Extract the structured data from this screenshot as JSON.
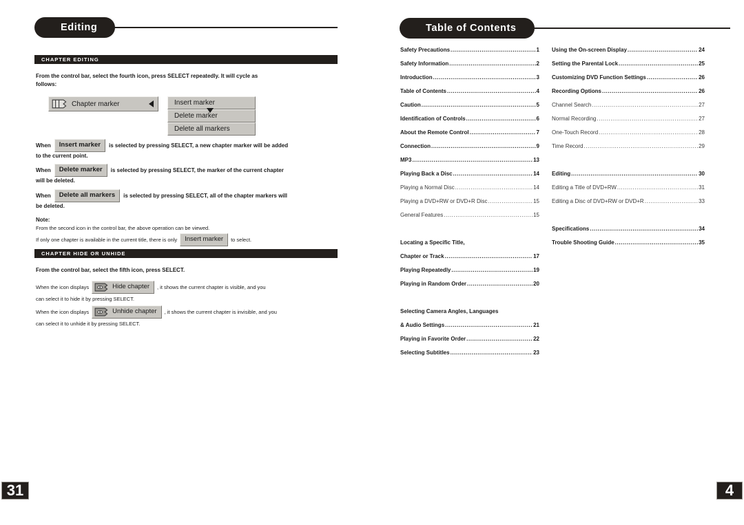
{
  "left_page": {
    "header": {
      "title": "Editing"
    },
    "page_number": "31",
    "sections": [
      {
        "band": "CHAPTER EDITING"
      },
      {
        "band": "CHAPTER HIDE OR UNHIDE"
      }
    ],
    "intro_line1": "From the control bar, select the fourth icon, press SELECT repeatedly. It will cycle as",
    "intro_line2": "follows:",
    "diagram": {
      "control_label": "Chapter marker",
      "control_icon": "chapter-marker-icon",
      "menu_options": [
        "Insert marker",
        "Delete marker",
        "Delete all markers"
      ]
    },
    "rules": [
      {
        "prefix": "When",
        "chip": "Insert marker",
        "line1": "is selected by pressing SELECT, a new chapter marker will be added",
        "line2": "to the current  point."
      },
      {
        "prefix": "When",
        "chip": "Delete marker",
        "line1": "is selected by pressing SELECT, the marker of the current chapter",
        "line2": "will be deleted."
      },
      {
        "prefix": "When",
        "chip": "Delete all markers",
        "line1": "is selected by pressing SELECT, all of the chapter markers will",
        "line2": "be deleted."
      }
    ],
    "note": {
      "title": "Note:",
      "line1": "From the second icon in the control bar, the above operation can be viewed.",
      "line2_a": "If only one chapter is available in the current title, there is only",
      "line2_chip": "Insert marker",
      "line2_b": "to select."
    },
    "hide_section": {
      "intro": "From the control bar, select the fifth icon, press SELECT.",
      "items": [
        {
          "prefix": "When the icon displays",
          "chip": "Hide chapter",
          "chip_icon": "hide-chapter-icon",
          "line1": ", it shows the current chapter is visible, and you",
          "line2": "can select it to hide it by pressing SELECT."
        },
        {
          "prefix": "When the icon displays",
          "chip": "Unhide chapter",
          "chip_icon": "unhide-chapter-icon",
          "line1": ", it shows the current chapter is invisible, and you",
          "line2": "can select it to unhide it by pressing SELECT."
        }
      ]
    }
  },
  "right_page": {
    "header": {
      "title": "Table of Contents"
    },
    "page_number": "4",
    "toc_left": [
      {
        "text": "Safety Precautions",
        "page": "1",
        "style": "bold"
      },
      {
        "text": "Safety Information",
        "page": "2",
        "style": "bold"
      },
      {
        "text": "Introduction",
        "page": "3",
        "style": "bold"
      },
      {
        "text": "Table of Contents",
        "page": "4",
        "style": "bold"
      },
      {
        "text": "Caution",
        "page": " 5",
        "style": "bold"
      },
      {
        "text": "Identification of Controls",
        "page": "6",
        "style": "bold"
      },
      {
        "text": "About the Remote Control",
        "page": "7",
        "style": "bold"
      },
      {
        "text": "Connection",
        "page": "9",
        "style": "bold"
      },
      {
        "text": "MP3",
        "page": "13",
        "style": "bold"
      },
      {
        "text": "Playing Back a Disc",
        "page": "14",
        "style": "bold"
      },
      {
        "text": "Playing a Normal Disc",
        "page": "14",
        "style": "plain"
      },
      {
        "text": "Playing a DVD+RW or DVD+R Disc",
        "page": "15",
        "style": "plain"
      },
      {
        "text": "General Features",
        "page": "15",
        "style": "plain"
      },
      {
        "text": "",
        "page": "",
        "style": "gap"
      },
      {
        "text": "Locating a Specific Title,",
        "page": "",
        "style": "bold-nopage"
      },
      {
        "text": "Chapter or Track",
        "page": "17",
        "style": "bold"
      },
      {
        "text": "Playing Repeatedly",
        "page": "19",
        "style": "bold"
      },
      {
        "text": "Playing in Random Order",
        "page": "20",
        "style": "bold"
      },
      {
        "text": "",
        "page": "",
        "style": "gap"
      },
      {
        "text": "Selecting Camera Angles, Languages",
        "page": "",
        "style": "bold-nopage"
      },
      {
        "text": "& Audio Settings",
        "page": "21",
        "style": "bold"
      },
      {
        "text": "Playing in Favorite Order",
        "page": " 22",
        "style": "bold"
      },
      {
        "text": "Selecting Subtitles",
        "page": " 23",
        "style": "bold"
      }
    ],
    "toc_right": [
      {
        "text": "Using the On-screen Display",
        "page": "24",
        "style": "bold"
      },
      {
        "text": "Setting the Parental Lock",
        "page": "25",
        "style": "bold"
      },
      {
        "text": "Customizing DVD Function Settings",
        "page": "26",
        "style": "bold"
      },
      {
        "text": "Recording Options",
        "page": "26",
        "style": "bold"
      },
      {
        "text": "Channel Search",
        "page": "27",
        "style": "plain"
      },
      {
        "text": "Normal Recording",
        "page": "27",
        "style": "plain"
      },
      {
        "text": "One-Touch Record",
        "page": "28",
        "style": "plain"
      },
      {
        "text": "Time Record",
        "page": "29",
        "style": "plain"
      },
      {
        "text": "",
        "page": "",
        "style": "gap"
      },
      {
        "text": "Editing",
        "page": "30",
        "style": "bold"
      },
      {
        "text": "Editing a Title of DVD+RW",
        "page": "31",
        "style": "plain"
      },
      {
        "text": "Editing a Disc of DVD+RW or DVD+R",
        "page": "33",
        "style": "plain"
      },
      {
        "text": "",
        "page": "",
        "style": "gap"
      },
      {
        "text": "Specifications",
        "page": "34",
        "style": "bold"
      },
      {
        "text": "Trouble Shooting Guide",
        "page": "35",
        "style": "bold"
      }
    ]
  },
  "colors": {
    "ink": "#231f1c",
    "chip_face": "#c8c6c1",
    "chip_light": "#f2f1ee",
    "chip_shadow": "#7d7b76"
  }
}
